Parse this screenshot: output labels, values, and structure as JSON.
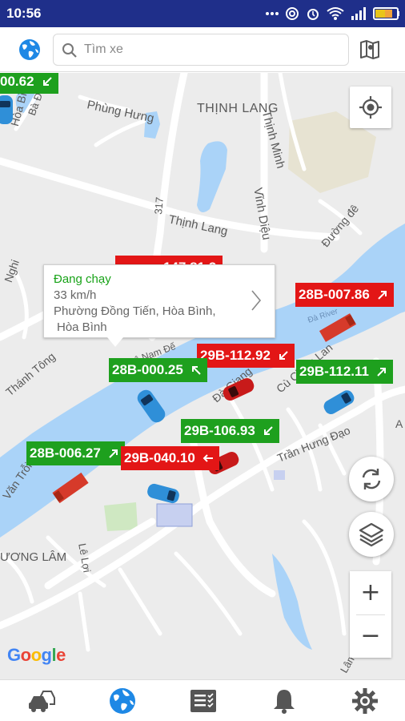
{
  "status_bar": {
    "time": "10:56"
  },
  "search": {
    "placeholder": "Tìm xe"
  },
  "map_labels": {
    "phung_hung": "Phùng Hưng",
    "thinh_lang": "THỊNH LANG",
    "thinh_minh": "Thịnh Minh",
    "vinh_dieu": "Vĩnh Diệu",
    "thinh_lang_street": "Thịnh Lang",
    "duong_de": "Đường đê",
    "ba_da": "Bà Đà",
    "hoa_binh": "Hòa Bình",
    "route_317": "317",
    "nghi": "Nghi",
    "thanh_tong": "Thánh Tông",
    "van_troi": "Văn Trỗi",
    "le_nam_de": "Lê Nam Đế",
    "da_giang": "Đà Giang",
    "cu_chinh_lan": "Cù Chính Lan",
    "tran_hung_dao": "Trần Hưng Đạo",
    "le_loi": "Lê Lợi",
    "phuong_lam": "ƯƠNG LÂM",
    "lam": "Lâm",
    "a": "A",
    "da_river": "Đà River"
  },
  "vehicles": [
    {
      "plate": "00.62",
      "color": "green",
      "arrow": "down-left"
    },
    {
      "plate": "28B-007.86",
      "color": "red",
      "arrow": "up-right"
    },
    {
      "plate": "29B-112.92",
      "color": "red",
      "arrow": "down-left"
    },
    {
      "plate": "28B-000.25",
      "color": "green",
      "arrow": "up-left"
    },
    {
      "plate": "29B-112.11",
      "color": "green",
      "arrow": "up-right"
    },
    {
      "plate": "29B-106.93",
      "color": "green",
      "arrow": "down-left"
    },
    {
      "plate": "28B-006.27",
      "color": "green",
      "arrow": "up-right"
    },
    {
      "plate": "29B-040.10",
      "color": "red",
      "arrow": "left"
    },
    {
      "plate": "147.81.2",
      "color": "red",
      "arrow": ""
    }
  ],
  "popup": {
    "status": "Đang chạy",
    "speed": "33 km/h",
    "address_line1": "Phường Đồng Tiến,  Hòa Bình,",
    "address_line2": "Hòa Bình"
  },
  "map_controls": {
    "zoom_in": "+",
    "zoom_out": "−"
  },
  "google_logo": {
    "G": "G",
    "o1": "o",
    "o2": "o",
    "g": "g",
    "l": "l",
    "e": "e"
  },
  "colors": {
    "status_bar": "#1f2f8a",
    "plate_green": "#1ea01e",
    "plate_red": "#e31616",
    "river": "#aad3f8",
    "popup_status": "#19a319",
    "accent_blue": "#1e88e5"
  },
  "icons": {
    "header_left": "globe-icon",
    "header_right": "map-mode-icon",
    "nav": [
      "vehicles-icon",
      "globe-icon",
      "report-list-icon",
      "bell-icon",
      "gear-icon"
    ]
  }
}
